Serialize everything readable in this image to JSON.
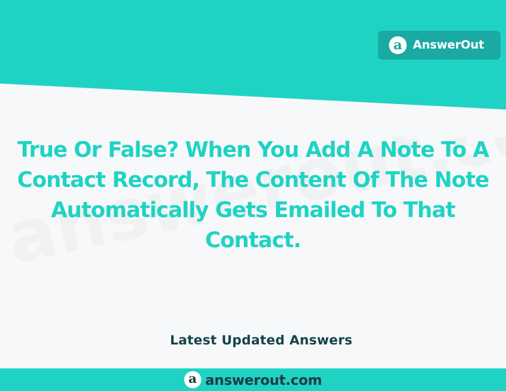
{
  "brand": {
    "name": "AnswerOut",
    "logo_letter": "a"
  },
  "watermark": {
    "text": "answerout.com"
  },
  "question": {
    "lines": [
      "True Or False? When You Add A Note To A",
      "Contact Record, The Content Of The Note",
      "Automatically Gets Emailed To That",
      "Contact."
    ]
  },
  "tagline": "Latest Updated Answers",
  "footer": {
    "logo_letter": "a",
    "site": "answerout.com"
  },
  "colors": {
    "accent": "#1fd3c4",
    "badge": "#1aa9a3",
    "dark_text": "#164347"
  }
}
